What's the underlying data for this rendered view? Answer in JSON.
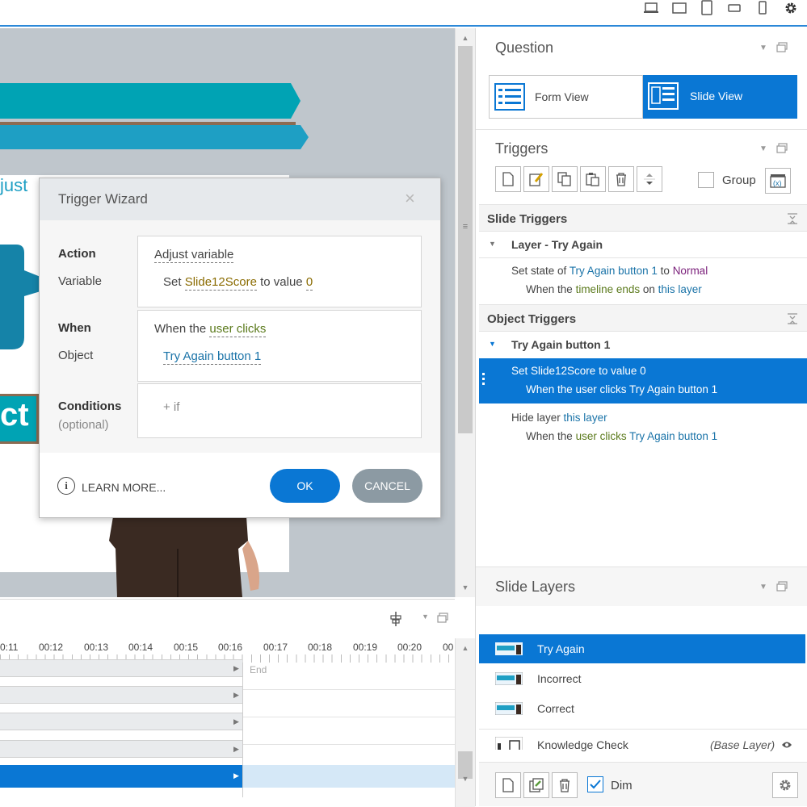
{
  "colors": {
    "accent": "#0a77d4",
    "teal": "#00a3b4",
    "cancel": "#8c9aa3"
  },
  "topbar": {
    "icons": [
      "laptop-icon",
      "tablet-landscape-icon",
      "tablet-portrait-icon",
      "phone-landscape-icon",
      "phone-portrait-icon",
      "gear-icon"
    ]
  },
  "slide": {
    "word_adjust": "just",
    "word_correct": "ct"
  },
  "wizard": {
    "title": "Trigger Wizard",
    "close": "×",
    "action_label": "Action",
    "action_value": "Adjust variable",
    "variable_label": "Variable",
    "set_word": "Set",
    "variable_name": "Slide12Score",
    "to_value_word": "to value",
    "value": "0",
    "when_label": "When",
    "when_prefix": "When the",
    "when_event": "user clicks",
    "object_label": "Object",
    "object_value": "Try Again button 1",
    "conditions_label": "Conditions",
    "conditions_optional": "(optional)",
    "add_if": "+ if",
    "learn_more": "LEARN MORE...",
    "ok": "OK",
    "cancel": "CANCEL"
  },
  "question": {
    "title": "Question",
    "form_view": "Form View",
    "slide_view": "Slide View"
  },
  "triggers": {
    "title": "Triggers",
    "group_label": "Group",
    "slide_triggers": "Slide Triggers",
    "layer_name": "Layer - Try Again",
    "slide_trigger": {
      "p1": "Set state of",
      "p2": "Try Again button 1",
      "p3": "to",
      "p4": "Normal",
      "p5": "When the",
      "p6": "timeline ends",
      "p7": "on",
      "p8": "this layer"
    },
    "object_triggers": "Object Triggers",
    "object_name": "Try Again button 1",
    "obj_trigger1": {
      "line1": "Set Slide12Score to value 0",
      "line2": "When the user clicks Try Again button 1"
    },
    "obj_trigger2": {
      "p1": "Hide layer",
      "p2": "this layer",
      "p3": "When the",
      "p4": "user clicks",
      "p5": "Try Again button 1"
    }
  },
  "layers": {
    "title": "Slide Layers",
    "items": [
      "Try Again",
      "Incorrect",
      "Correct"
    ],
    "base_name": "Knowledge Check",
    "base_tag": "(Base Layer)",
    "dim_label": "Dim"
  },
  "timeline": {
    "ticks": [
      "0:11",
      "00:12",
      "00:13",
      "00:14",
      "00:15",
      "00:16",
      "00:17",
      "00:18",
      "00:19",
      "00:20",
      "00"
    ],
    "end_label": "End"
  }
}
